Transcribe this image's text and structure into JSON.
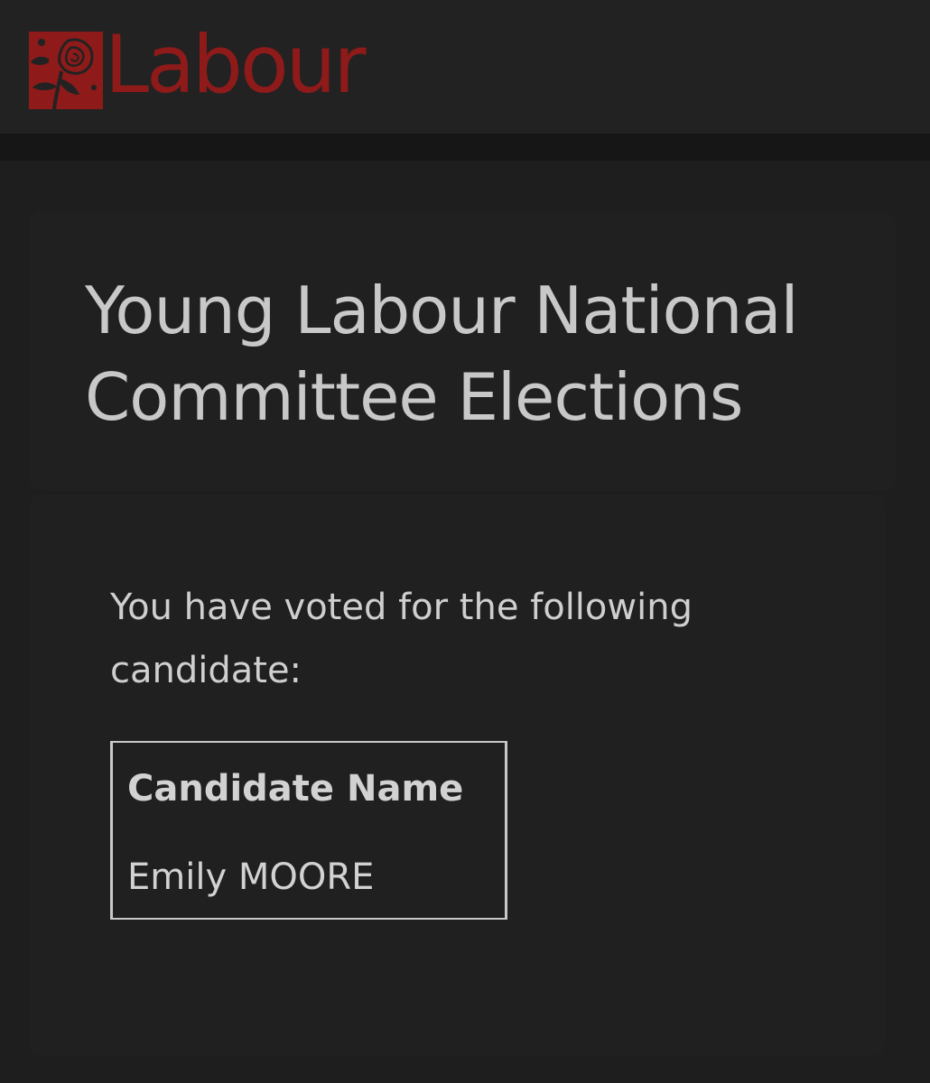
{
  "header": {
    "logo_text": "Labour",
    "brand_color": "#8e1a1a",
    "logo_icon": "rose-icon"
  },
  "main": {
    "title": "Young Labour National Committee Elections",
    "vote_message": "You have voted for the following candidate:",
    "table": {
      "header": "Candidate Name",
      "value": "Emily MOORE"
    }
  },
  "colors": {
    "background": "#1e1e1e",
    "header_background": "#222222",
    "text": "#c8c8c8"
  }
}
